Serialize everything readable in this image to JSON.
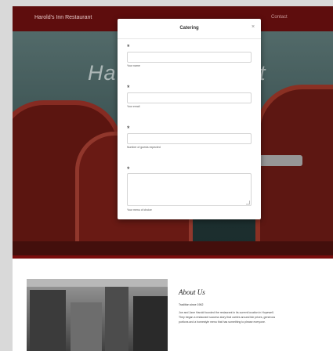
{
  "navbar": {
    "brand": "Harold's Inn Restaurant",
    "trailing_item": "Contact"
  },
  "hero": {
    "title_left": "Ha",
    "title_right": "nt"
  },
  "modal": {
    "title": "Catering",
    "close_glyph": "×",
    "required_marker": "*",
    "fields": [
      {
        "hint": "Your name"
      },
      {
        "hint": "Your email"
      },
      {
        "hint": "Number of guests expected"
      }
    ],
    "textarea_hint": "Your menu of choice"
  },
  "about": {
    "title": "About Us",
    "subtitle": "Tradition since 1962",
    "body": "Joe and Jane Harold founded the restaurant in its current location in Hopewell. They began a restaurant success story that carries around fair prices, generous portions and a homestyle menu that has something to please everyone."
  },
  "colors": {
    "navbar_bg": "#5e0d0d",
    "accent_red": "#7a0d0d",
    "modal_bg": "#ffffff"
  }
}
